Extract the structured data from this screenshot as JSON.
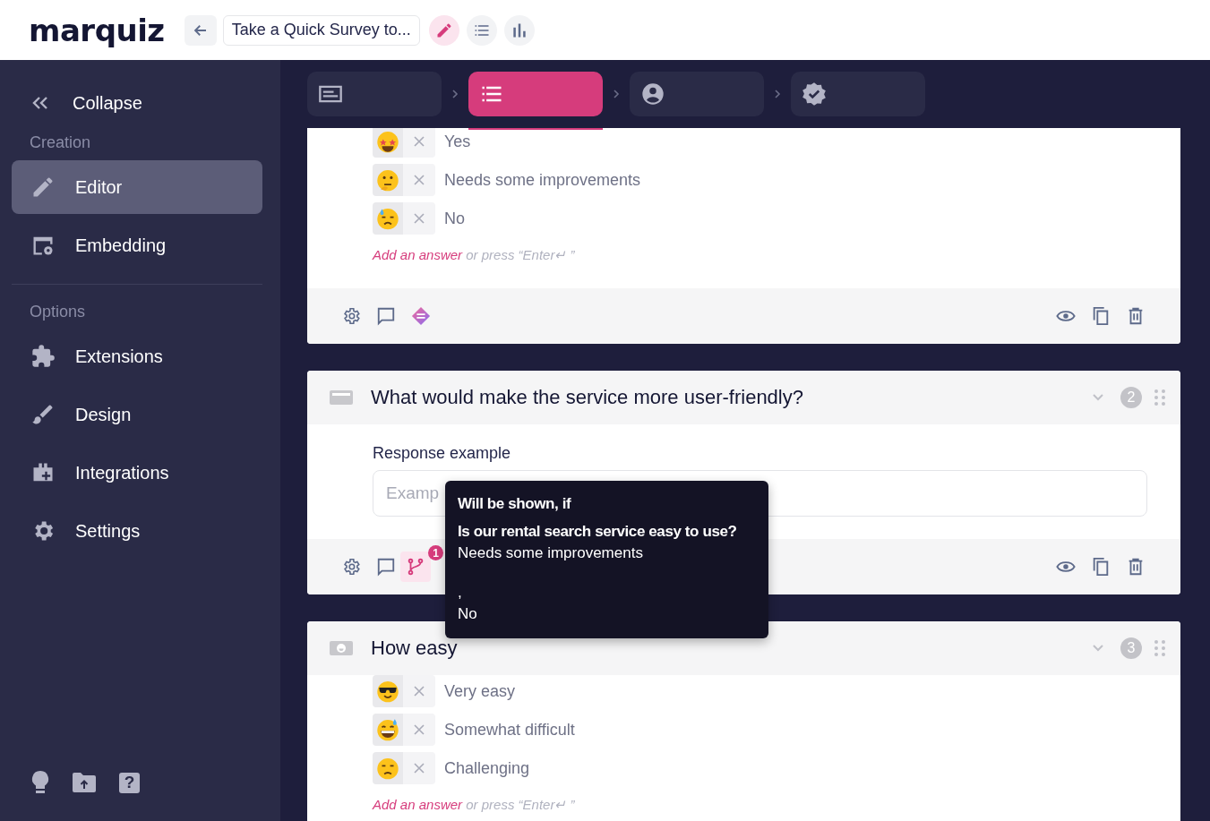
{
  "header": {
    "logo": "marquiz",
    "title": "Take a Quick Survey to...",
    "modes": [
      {
        "kind": "edit",
        "selected": true
      },
      {
        "kind": "list",
        "selected": false
      },
      {
        "kind": "results",
        "selected": false
      }
    ]
  },
  "sidebar": {
    "collapse": "Collapse",
    "sections": [
      {
        "title": "Creation",
        "items": [
          {
            "kind": "editor",
            "label": "Editor",
            "selected": true
          },
          {
            "kind": "embedding",
            "label": "Embedding",
            "selected": false
          }
        ]
      },
      {
        "title": "Options",
        "items": [
          {
            "kind": "extensions",
            "label": "Extensions",
            "selected": false
          },
          {
            "kind": "design",
            "label": "Design",
            "selected": false
          },
          {
            "kind": "integrations",
            "label": "Integrations",
            "selected": false
          },
          {
            "kind": "settings",
            "label": "Settings",
            "selected": false
          }
        ]
      }
    ],
    "tools": [
      {
        "kind": "idea"
      },
      {
        "kind": "upload"
      },
      {
        "kind": "help",
        "label": "?"
      }
    ]
  },
  "steps": [
    {
      "kind": "start",
      "selected": false
    },
    {
      "kind": "questions",
      "selected": true
    },
    {
      "kind": "contacts",
      "selected": false
    },
    {
      "kind": "result",
      "selected": false
    }
  ],
  "questions": [
    {
      "kind": "choice",
      "answers": [
        {
          "label": "Yes"
        },
        {
          "label": "Needs some improvements"
        },
        {
          "label": "No"
        }
      ],
      "add_answer": "Add an answer",
      "add_hint": "or press “Enter↵ ”",
      "logic": {
        "kind": "assistant"
      }
    },
    {
      "kind": "text",
      "title": "What would make the service more user-friendly?",
      "number": "2",
      "field_label": "Response example",
      "placeholder": "Examp",
      "logic": {
        "kind": "branch",
        "badge": "1",
        "selected": true
      }
    },
    {
      "kind": "choice",
      "title": "How easy",
      "number": "3",
      "answers": [
        {
          "label": "Very easy"
        },
        {
          "label": "Somewhat difficult"
        },
        {
          "label": "Challenging"
        }
      ],
      "add_answer": "Add an answer",
      "add_hint": "or press “Enter↵ ”"
    }
  ],
  "tooltip": {
    "title": "Will be shown, if",
    "question": "Is our rental search service easy to use?",
    "lines": [
      "Needs some improvements",
      ",",
      "No"
    ]
  }
}
